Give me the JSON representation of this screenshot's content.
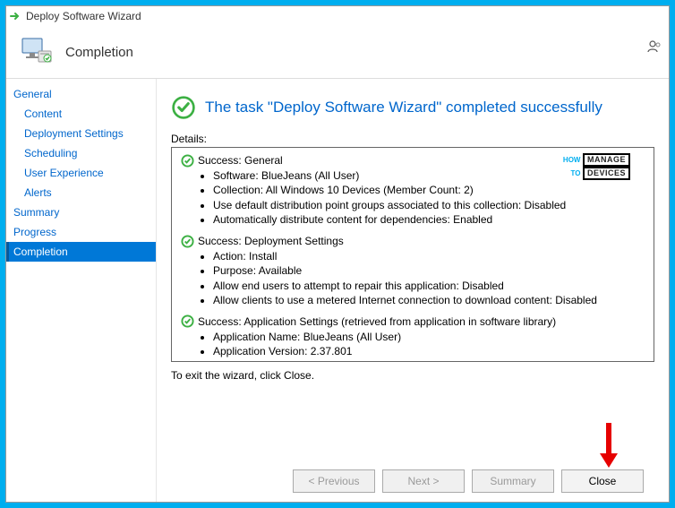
{
  "window": {
    "title": "Deploy Software Wizard"
  },
  "header": {
    "title": "Completion"
  },
  "sidebar": {
    "items": [
      {
        "label": "General",
        "level": 0
      },
      {
        "label": "Content",
        "level": 1
      },
      {
        "label": "Deployment Settings",
        "level": 1
      },
      {
        "label": "Scheduling",
        "level": 1
      },
      {
        "label": "User Experience",
        "level": 1
      },
      {
        "label": "Alerts",
        "level": 1
      },
      {
        "label": "Summary",
        "level": 0
      },
      {
        "label": "Progress",
        "level": 0
      },
      {
        "label": "Completion",
        "level": 0,
        "selected": true
      }
    ]
  },
  "main": {
    "success_title": "The task \"Deploy Software Wizard\" completed successfully",
    "details_label": "Details:",
    "groups": [
      {
        "header": "Success: General",
        "items": [
          "Software: BlueJeans (All User)",
          "Collection: All Windows 10 Devices (Member Count: 2)",
          "Use default distribution point groups associated to this collection: Disabled",
          "Automatically distribute content for dependencies: Enabled"
        ]
      },
      {
        "header": "Success: Deployment Settings",
        "items": [
          "Action: Install",
          "Purpose: Available",
          "Allow end users to attempt to repair this application: Disabled",
          "Allow clients to use a metered Internet connection to download content: Disabled"
        ]
      },
      {
        "header": "Success: Application Settings (retrieved from application in software library)",
        "items": [
          "Application Name: BlueJeans (All User)",
          "Application Version: 2.37.801"
        ]
      }
    ],
    "exit_note": "To exit the wizard, click Close."
  },
  "footer": {
    "previous": "< Previous",
    "next": "Next >",
    "summary": "Summary",
    "close": "Close"
  },
  "watermark": {
    "how": "HOW",
    "to": "TO",
    "manage": "MANAGE",
    "devices": "DEVICES"
  }
}
